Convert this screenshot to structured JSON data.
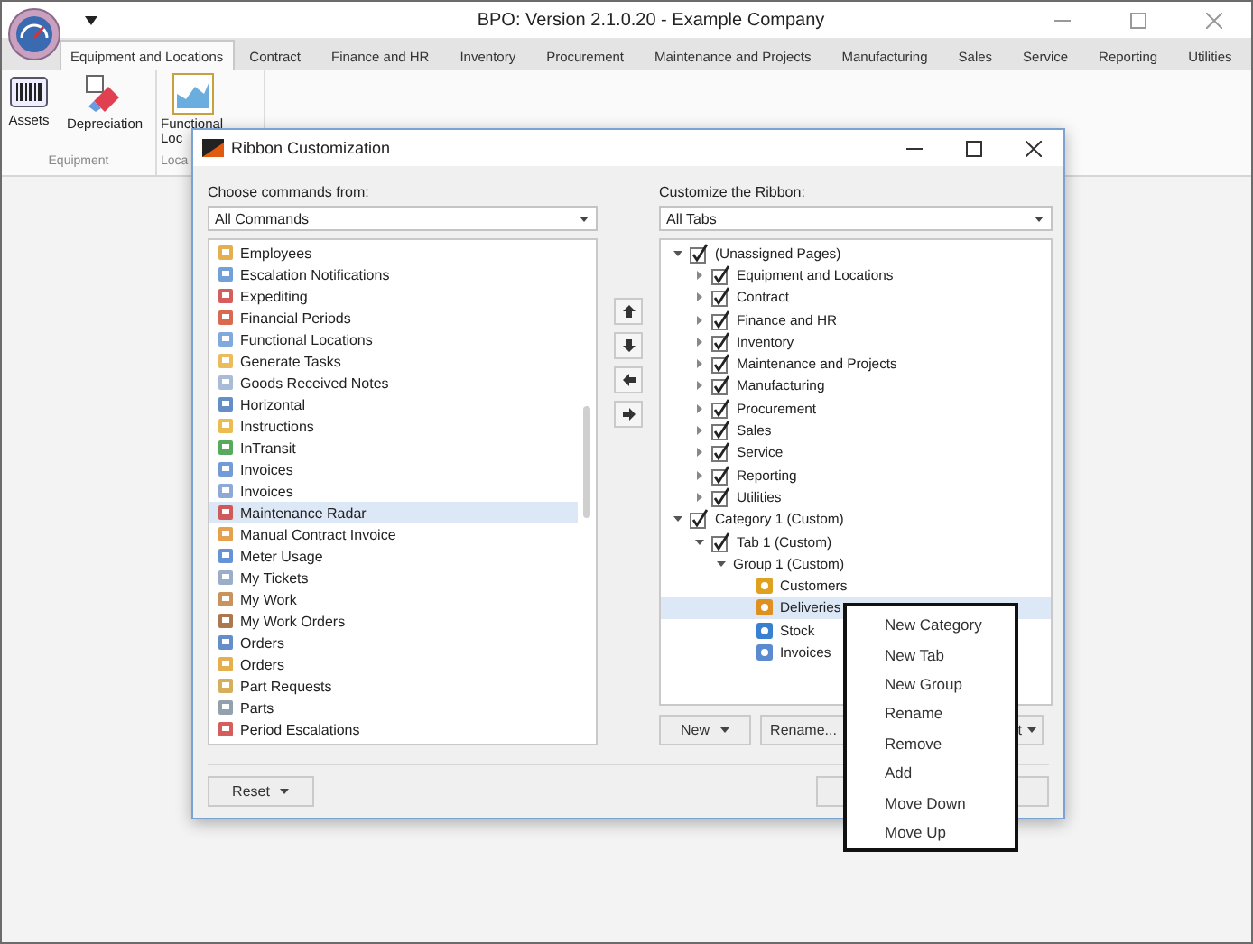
{
  "window": {
    "title": "BPO: Version 2.1.0.20 - Example Company"
  },
  "tabs": [
    {
      "label": "Equipment and Locations",
      "selected": true
    },
    {
      "label": "Contract",
      "selected": false
    },
    {
      "label": "Finance and HR",
      "selected": false
    },
    {
      "label": "Inventory",
      "selected": false
    },
    {
      "label": "Procurement",
      "selected": false
    },
    {
      "label": "Maintenance and Projects",
      "selected": false
    },
    {
      "label": "Manufacturing",
      "selected": false
    },
    {
      "label": "Sales",
      "selected": false
    },
    {
      "label": "Service",
      "selected": false
    },
    {
      "label": "Reporting",
      "selected": false
    },
    {
      "label": "Utilities",
      "selected": false
    }
  ],
  "ribbon": {
    "groups": [
      {
        "label": "Equipment",
        "buttons": [
          {
            "label": "Assets",
            "kind": "barcode"
          },
          {
            "label": "Depreciation",
            "kind": "eraser"
          }
        ]
      },
      {
        "label": "Loca",
        "buttons": [
          {
            "label": "Functional Loc",
            "kind": "chart"
          }
        ]
      }
    ]
  },
  "dialog": {
    "title": "Ribbon Customization",
    "left": {
      "label": "Choose commands from:",
      "combo": "All Commands",
      "items": [
        {
          "label": "Employees",
          "selected": false
        },
        {
          "label": "Escalation Notifications",
          "selected": false
        },
        {
          "label": "Expediting",
          "selected": false
        },
        {
          "label": "Financial Periods",
          "selected": false
        },
        {
          "label": "Functional Locations",
          "selected": false
        },
        {
          "label": "Generate Tasks",
          "selected": false
        },
        {
          "label": "Goods Received Notes",
          "selected": false
        },
        {
          "label": "Horizontal",
          "selected": false
        },
        {
          "label": "Instructions",
          "selected": false
        },
        {
          "label": "InTransit",
          "selected": false
        },
        {
          "label": "Invoices",
          "selected": false
        },
        {
          "label": "Invoices",
          "selected": false
        },
        {
          "label": "Maintenance Radar",
          "selected": true
        },
        {
          "label": "Manual Contract Invoice",
          "selected": false
        },
        {
          "label": "Meter Usage",
          "selected": false
        },
        {
          "label": "My Tickets",
          "selected": false
        },
        {
          "label": "My Work",
          "selected": false
        },
        {
          "label": "My Work Orders",
          "selected": false
        },
        {
          "label": "Orders",
          "selected": false
        },
        {
          "label": "Orders",
          "selected": false
        },
        {
          "label": "Part Requests",
          "selected": false
        },
        {
          "label": "Parts",
          "selected": false
        },
        {
          "label": "Period Escalations",
          "selected": false
        }
      ]
    },
    "right": {
      "label": "Customize the Ribbon:",
      "combo": "All Tabs",
      "tree": [
        {
          "kind": "node",
          "label": "(Unassigned Pages)",
          "checked": true,
          "expanded": true,
          "selected": false,
          "children": [
            {
              "kind": "node",
              "label": "Equipment and Locations",
              "checked": true,
              "expanded": false,
              "selected": false
            },
            {
              "kind": "node",
              "label": "Contract",
              "checked": true,
              "expanded": false,
              "selected": false
            },
            {
              "kind": "node",
              "label": "Finance and HR",
              "checked": true,
              "expanded": false,
              "selected": false
            },
            {
              "kind": "node",
              "label": "Inventory",
              "checked": true,
              "expanded": false,
              "selected": false
            },
            {
              "kind": "node",
              "label": "Maintenance and Projects",
              "checked": true,
              "expanded": false,
              "selected": false
            },
            {
              "kind": "node",
              "label": "Manufacturing",
              "checked": true,
              "expanded": false,
              "selected": false
            },
            {
              "kind": "node",
              "label": "Procurement",
              "checked": true,
              "expanded": false,
              "selected": false
            },
            {
              "kind": "node",
              "label": "Sales",
              "checked": true,
              "expanded": false,
              "selected": false
            },
            {
              "kind": "node",
              "label": "Service",
              "checked": true,
              "expanded": false,
              "selected": false
            },
            {
              "kind": "node",
              "label": "Reporting",
              "checked": true,
              "expanded": false,
              "selected": false
            },
            {
              "kind": "node",
              "label": "Utilities",
              "checked": true,
              "expanded": false,
              "selected": false
            }
          ]
        },
        {
          "kind": "node",
          "label": "Category 1 (Custom)",
          "checked": true,
          "expanded": true,
          "selected": false,
          "children": [
            {
              "kind": "node",
              "label": "Tab 1 (Custom)",
              "checked": true,
              "expanded": true,
              "selected": false,
              "children": [
                {
                  "kind": "group",
                  "label": "Group 1 (Custom)",
                  "expanded": true,
                  "selected": false,
                  "children": [
                    {
                      "kind": "command",
                      "label": "Customers",
                      "selected": false
                    },
                    {
                      "kind": "command",
                      "label": "Deliveries",
                      "selected": true
                    },
                    {
                      "kind": "command",
                      "label": "Stock",
                      "selected": false
                    },
                    {
                      "kind": "command",
                      "label": "Invoices",
                      "selected": false
                    }
                  ]
                }
              ]
            }
          ]
        }
      ]
    },
    "buttons": {
      "new": "New",
      "rename": "Rename...",
      "partial": "t",
      "reset": "Reset"
    }
  },
  "context_menu": [
    "New Category",
    "New Tab",
    "New Group",
    "Rename",
    "Remove",
    "Add",
    "Move Down",
    "Move Up"
  ]
}
